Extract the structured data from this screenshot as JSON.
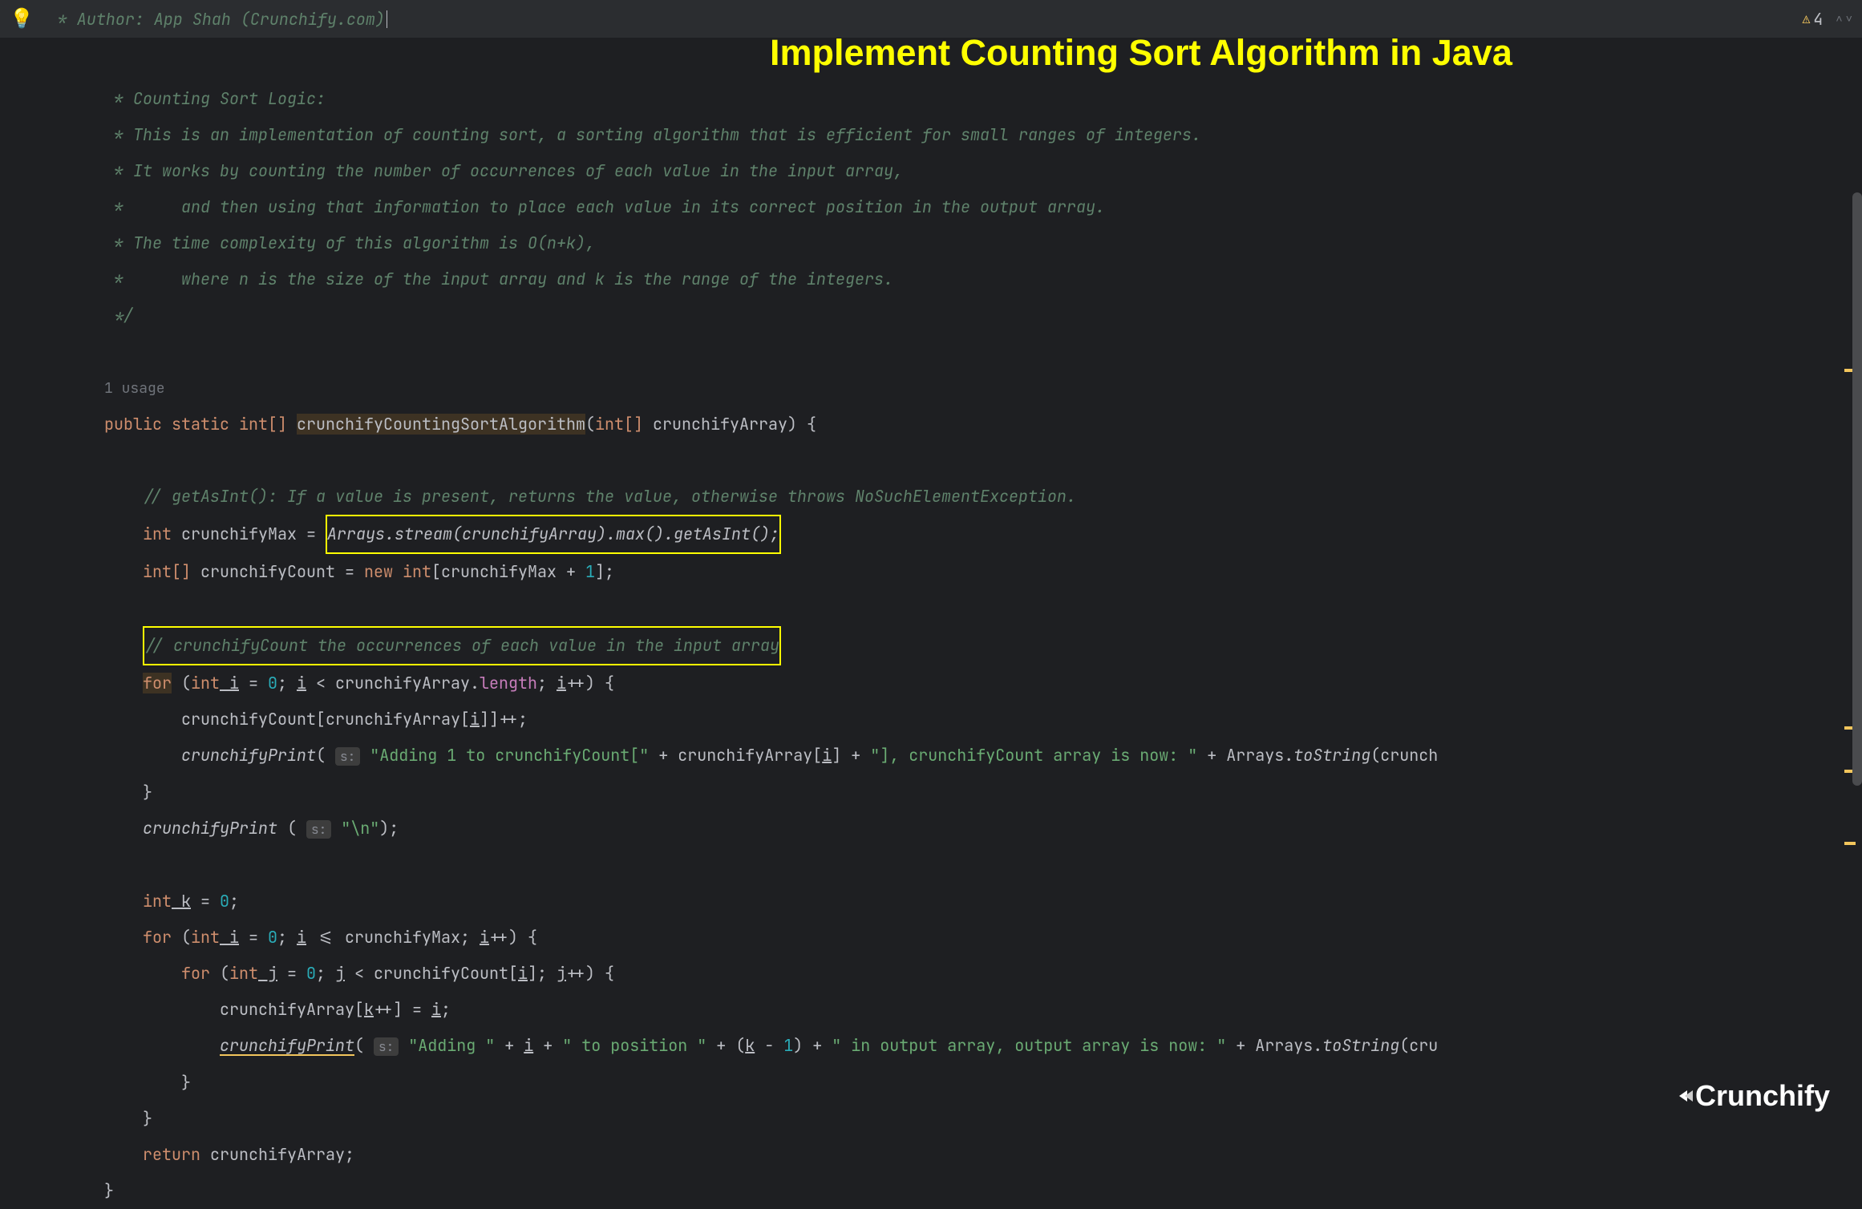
{
  "toolbar": {
    "author_text": " * Author: App Shah (Crunchify.com)",
    "warning_count": "4"
  },
  "overlay": {
    "title": "Implement Counting Sort Algorithm in Java"
  },
  "code": {
    "c1": " * Counting Sort Logic:",
    "c2": " * This is an implementation of counting sort, a sorting algorithm that is efficient for small ranges of integers.",
    "c3": " * It works by counting the number of occurrences of each value in the input array,",
    "c4": " *      and then using that information to place each value in its correct position in the output array.",
    "c5": " * The time complexity of this algorithm is O(n+k),",
    "c6": " *      where n is the size of the input array and k is the range of the integers.",
    "c7": " */",
    "usage": "1 usage",
    "kw_public": "public",
    "kw_static": "static",
    "kw_int_arr": "int[]",
    "method": "crunchifyCountingSortAlgorithm",
    "kw_int_arr2": "int[]",
    "param": " crunchifyArray) {",
    "c8": "// getAsInt(): If a value is present, returns the value, otherwise throws NoSuchElementException.",
    "kw_int": "int",
    "var_max": " crunchifyMax = ",
    "arrays": "Arrays",
    "stream_call": ".stream(crunchifyArray).max().getAsInt();",
    "decl_count": " crunchifyCount = ",
    "kw_new": "new",
    "kw_int2": " int",
    "brackets": "[crunchifyMax + ",
    "one": "1",
    "close_bracket": "];",
    "c9": "// crunchifyCount the occurrences of each value in the input array",
    "kw_for": "for",
    "for1": " (",
    "kw_int3": "int",
    "for_i": " i",
    "eq": " = ",
    "zero": "0",
    "semi_i": "; ",
    "i_var": "i",
    "lt": " < crunchifyArray.",
    "length": "length",
    "ipp": "; ",
    "i_inc": "i",
    "inc_close": "++) {",
    "count_inc": "crunchifyCount[crunchifyArray[",
    "i_idx": "i",
    "count_inc2": "]]++;",
    "print1": "crunchifyPrint",
    "str1": "\"Adding 1 to crunchifyCount[\"",
    "plus1": " + crunchifyArray[",
    "i_idx2": "i",
    "plus2": "] + ",
    "str2": "\"], crunchifyCount array is now: \"",
    "plus3": " + Arrays.",
    "tostring": "toString",
    "tostring_arg": "(crunch",
    "brace_close": "}",
    "print2": "crunchifyPrint",
    "newline_str": "\"\\n\"",
    "decl_k": " k",
    "zero2": "0",
    "semi": ";",
    "kw_for2": "for",
    "for2_open": " (",
    "kw_int4": "int",
    "for2_i": " i",
    "zero3": "0",
    "for2_semi": "; ",
    "for2_iv": "i",
    "lte": " <= crunchifyMax; ",
    "for2_inc": "i",
    "for2_close": "++) {",
    "kw_for3": "for",
    "for3_open": " (",
    "kw_int5": "int",
    "for3_j": " j",
    "zero4": "0",
    "for3_semi": "; ",
    "for3_jv": "j",
    "lt2": " < crunchifyCount[",
    "for3_iv": "i",
    "for3_close": "]; ",
    "for3_jinc": "j",
    "for3_close2": "++) {",
    "arr_assign": "crunchifyArray[",
    "k_var": "k",
    "arr_assign2": "++] = ",
    "i_assign": "i",
    "print3": "crunchifyPrint",
    "str3": "\"Adding \"",
    "plus_i": " + ",
    "i_var3": "i",
    "plus_str": " + ",
    "str4": "\" to position \"",
    "plus_k": " + (",
    "k_var2": "k",
    "minus_one": " - ",
    "one2": "1",
    "plus_str2": ") + ",
    "str5": "\" in output array, output array is now: \"",
    "plus_arr": " + Arrays.",
    "tostring2": "toString",
    "tostring_arg2": "(cru",
    "kw_return": "return",
    "ret_val": " crunchifyArray;",
    "s_hint": "s:"
  },
  "logo": {
    "text": "Crunchify"
  }
}
